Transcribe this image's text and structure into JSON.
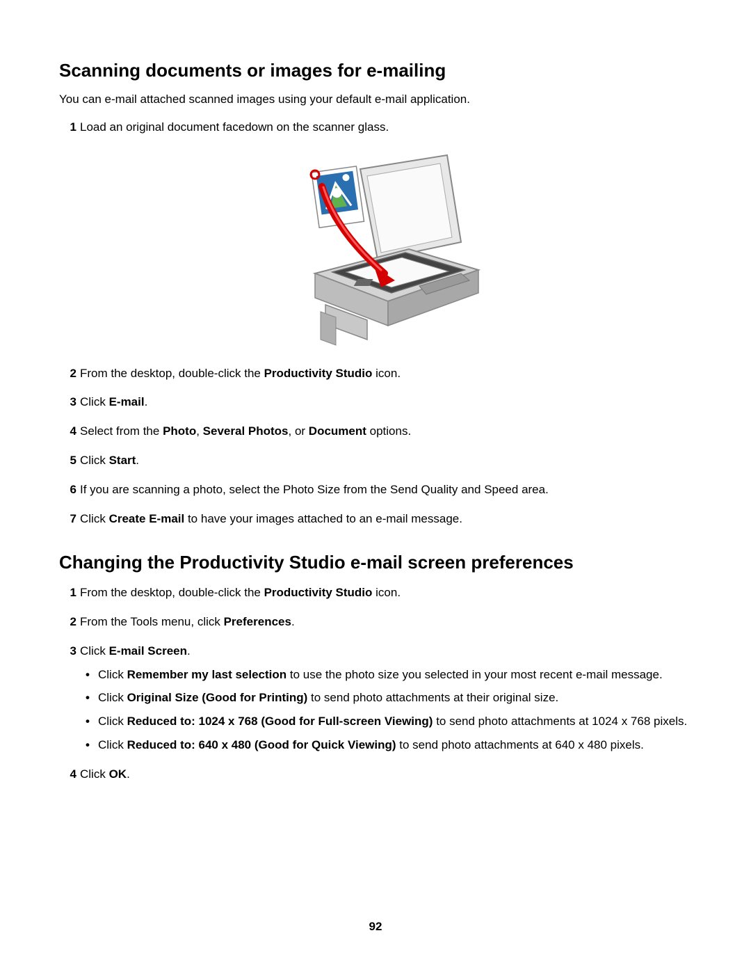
{
  "section1": {
    "heading": "Scanning documents or images for e-mailing",
    "intro": "You can e-mail attached scanned images using your default e-mail application.",
    "steps": [
      {
        "n": "1",
        "text": "Load an original document facedown on the scanner glass."
      },
      {
        "n": "2",
        "pre": "From the desktop, double-click the ",
        "b1": "Productivity Studio",
        "post": " icon."
      },
      {
        "n": "3",
        "pre": "Click ",
        "b1": "E-mail",
        "post": "."
      },
      {
        "n": "4",
        "pre": "Select from the ",
        "b1": "Photo",
        "mid1": ", ",
        "b2": "Several Photos",
        "mid2": ", or ",
        "b3": "Document",
        "post": " options."
      },
      {
        "n": "5",
        "pre": "Click ",
        "b1": "Start",
        "post": "."
      },
      {
        "n": "6",
        "text": "If you are scanning a photo, select the Photo Size from the Send Quality and Speed area."
      },
      {
        "n": "7",
        "pre": "Click ",
        "b1": "Create E-mail",
        "post": " to have your images attached to an e-mail message."
      }
    ]
  },
  "section2": {
    "heading": "Changing the Productivity Studio e-mail screen preferences",
    "steps": [
      {
        "n": "1",
        "pre": "From the desktop, double-click the ",
        "b1": "Productivity Studio",
        "post": " icon."
      },
      {
        "n": "2",
        "pre": "From the Tools menu, click ",
        "b1": "Preferences",
        "post": "."
      },
      {
        "n": "3",
        "pre": "Click ",
        "b1": "E-mail Screen",
        "post": ".",
        "bullets": [
          {
            "pre": "Click ",
            "b": "Remember my last selection",
            "post": " to use the photo size you selected in your most recent e-mail message."
          },
          {
            "pre": "Click ",
            "b": "Original Size (Good for Printing)",
            "post": " to send photo attachments at their original size."
          },
          {
            "pre": "Click ",
            "b": "Reduced to: 1024 x 768 (Good for Full-screen Viewing)",
            "post": " to send photo attachments at 1024 x 768 pixels."
          },
          {
            "pre": "Click ",
            "b": "Reduced to: 640 x 480 (Good for Quick Viewing)",
            "post": " to send photo attachments at 640 x 480 pixels."
          }
        ]
      },
      {
        "n": "4",
        "pre": "Click ",
        "b1": "OK",
        "post": "."
      }
    ]
  },
  "pageNumber": "92"
}
